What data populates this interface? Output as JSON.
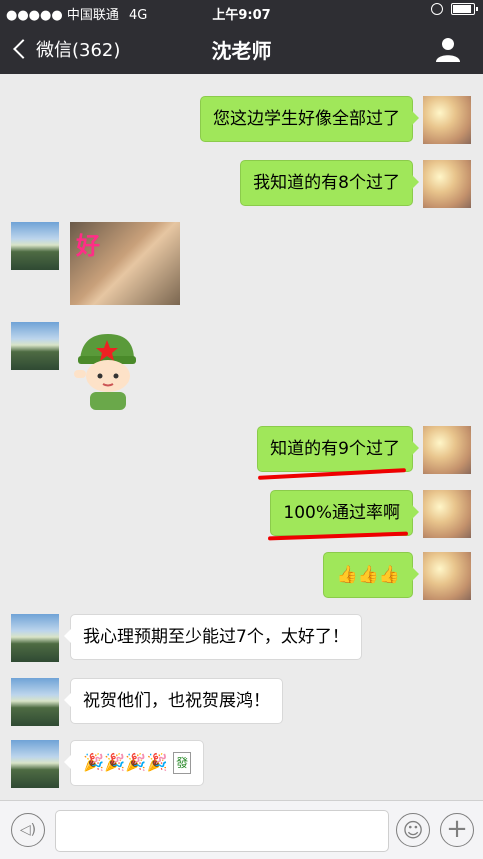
{
  "status_bar": {
    "carrier": "●●●●● 中国联通",
    "network": "4G",
    "time": "上午9:07"
  },
  "nav": {
    "back_label": "微信(362)",
    "title": "沈老师"
  },
  "messages": [
    {
      "side": "me",
      "type": "text",
      "text": "您这边学生好像全部过了"
    },
    {
      "side": "me",
      "type": "text",
      "text": "我知道的有8个过了"
    },
    {
      "side": "them",
      "type": "sticker",
      "description": "好",
      "caption": "好"
    },
    {
      "side": "them",
      "type": "sticker",
      "description": "saluting cartoon soldier"
    },
    {
      "side": "me",
      "type": "text",
      "text": "知道的有9个过了",
      "underlined": true
    },
    {
      "side": "me",
      "type": "text",
      "text": "100%通过率啊",
      "underlined": true
    },
    {
      "side": "me",
      "type": "emoji",
      "text": "👍👍👍"
    },
    {
      "side": "them",
      "type": "text",
      "text": "我心理预期至少能过7个，太好了！"
    },
    {
      "side": "them",
      "type": "text",
      "text": "祝贺他们，也祝贺展鸿！"
    },
    {
      "side": "them",
      "type": "emoji",
      "text": "🎉🎉🎉🎉",
      "tile": "發"
    }
  ],
  "input_bar": {
    "placeholder": ""
  },
  "icons": [
    "back-chevron-icon",
    "person-icon",
    "voice-icon",
    "emoji-icon",
    "plus-icon",
    "battery-icon",
    "lock-rotation-icon"
  ],
  "colors": {
    "nav_bg": "#2e2e33",
    "chat_bg": "#ebebeb",
    "my_bubble": "#a0e75a",
    "their_bubble": "#ffffff",
    "underline": "#ee0000"
  }
}
